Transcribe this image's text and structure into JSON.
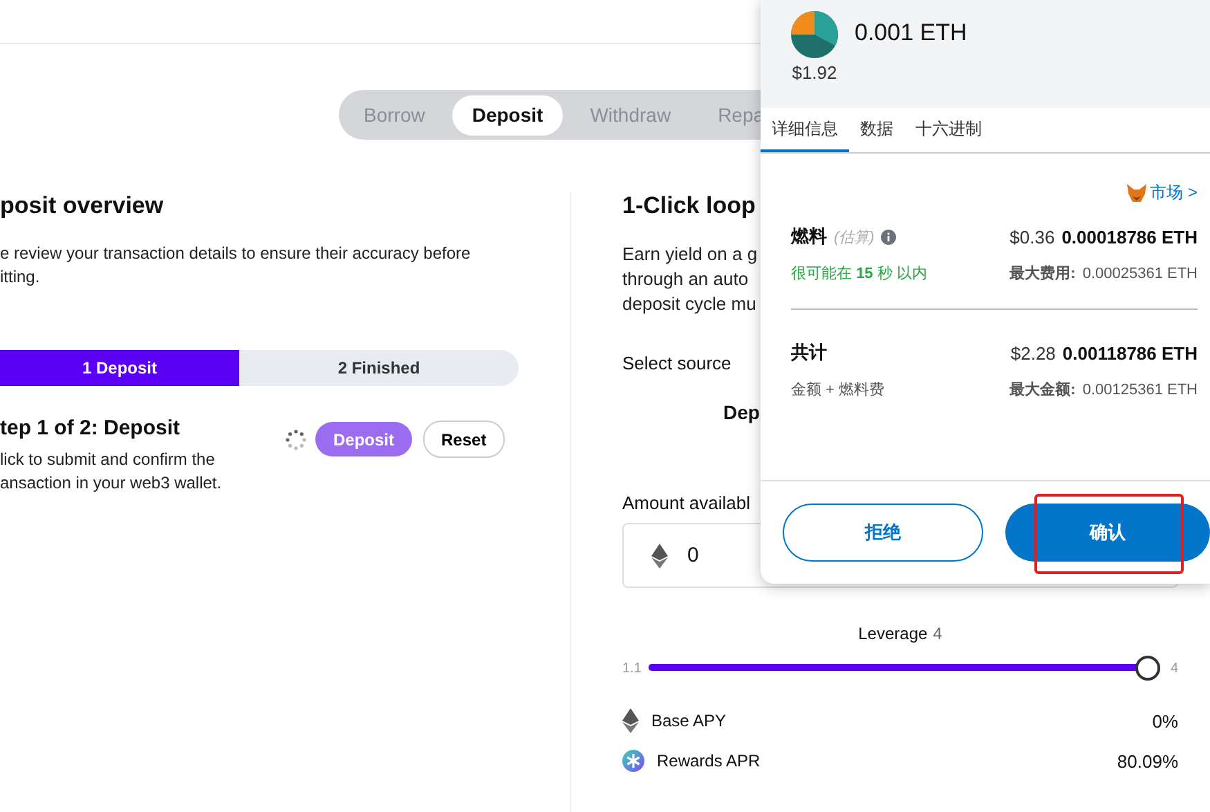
{
  "tabs": [
    {
      "label": "Borrow",
      "selected": false
    },
    {
      "label": "Deposit",
      "selected": true
    },
    {
      "label": "Withdraw",
      "selected": false
    },
    {
      "label": "Repa",
      "selected": false
    }
  ],
  "overview": {
    "title": "posit overview",
    "text_lines": [
      "e review your transaction details to ensure their accuracy before",
      "itting."
    ],
    "steps": [
      {
        "number": "1",
        "label": "Deposit",
        "active": true
      },
      {
        "number": "2",
        "label": "Finished",
        "active": false
      }
    ],
    "step_title": "tep 1 of 2: Deposit",
    "step_lines": [
      "lick to submit and confirm the",
      "ansaction in your web3 wallet."
    ],
    "deposit_button": "Deposit",
    "reset_button": "Reset"
  },
  "loop": {
    "title": "1-Click loop",
    "text_lines": [
      "Earn yield on a g",
      "through an auto",
      "deposit cycle mu"
    ],
    "select_label": "Select source",
    "source": "Dep",
    "amount_label": "Amount availabl",
    "amount_value": "0",
    "leverage": {
      "label": "Leverage",
      "value": "4",
      "min": "1.1",
      "max": "4",
      "level": 1.0
    },
    "rates": [
      {
        "kind": "eth",
        "label": "Base APY",
        "value": "0%"
      },
      {
        "kind": "rewards",
        "label": "Rewards APR",
        "value": "80.09%"
      }
    ]
  },
  "wallet": {
    "amount": "0.001 ETH",
    "usd": "$1.92",
    "tabs": [
      {
        "label": "详细信息",
        "selected": true
      },
      {
        "label": "数据",
        "selected": false
      },
      {
        "label": "十六进制",
        "selected": false
      }
    ],
    "market_link": "市场 >",
    "gas": {
      "label": "燃料",
      "note": "(估算)",
      "usd": "$0.36",
      "eth": "0.00018786 ETH",
      "time": "很可能在 **15** 秒 以内",
      "max_label": "最大费用:",
      "max_value": "0.00025361 ETH"
    },
    "total": {
      "label": "共计",
      "usd": "$2.28",
      "eth": "0.00118786 ETH",
      "sub": "金额 + 燃料费",
      "max_label": "最大金额:",
      "max_value": "0.00125361 ETH"
    },
    "reject_button": "拒绝",
    "confirm_button": "确认"
  }
}
